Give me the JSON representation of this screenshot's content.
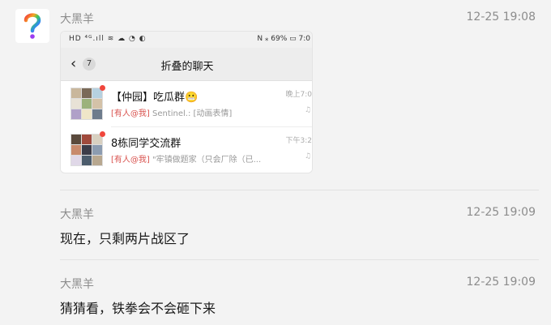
{
  "messages": [
    {
      "sender": "大黑羊",
      "time": "12-25 19:08"
    },
    {
      "sender": "大黑羊",
      "time": "12-25 19:09",
      "text": "现在，只剩两片战区了"
    },
    {
      "sender": "大黑羊",
      "time": "12-25 19:09",
      "text": "猜猜看，铁拳会不会砸下来"
    }
  ],
  "avatar": {
    "glyph": "?",
    "icon": "rainbow-question-mark-icon"
  },
  "screenshot": {
    "status_left": "HD ⁴ᴳ.ıll ≋ ☁ ◔ ◐",
    "status_right": "N ⁎ 69% ▭ 7:0",
    "back_badge": "7",
    "title": "折叠的聊天",
    "chats": [
      {
        "name": "【仲园】吃瓜群😬",
        "mention": "[有人@我]",
        "preview": " Sentinel.: [动画表情]",
        "time": "晚上7:0",
        "mute": "♫"
      },
      {
        "name": "8栋同学交流群",
        "mention": "[有人@我]",
        "preview": " \"牢镇做题家（只会厂除（已...",
        "time": "下午3:2",
        "mute": "♫"
      }
    ]
  }
}
